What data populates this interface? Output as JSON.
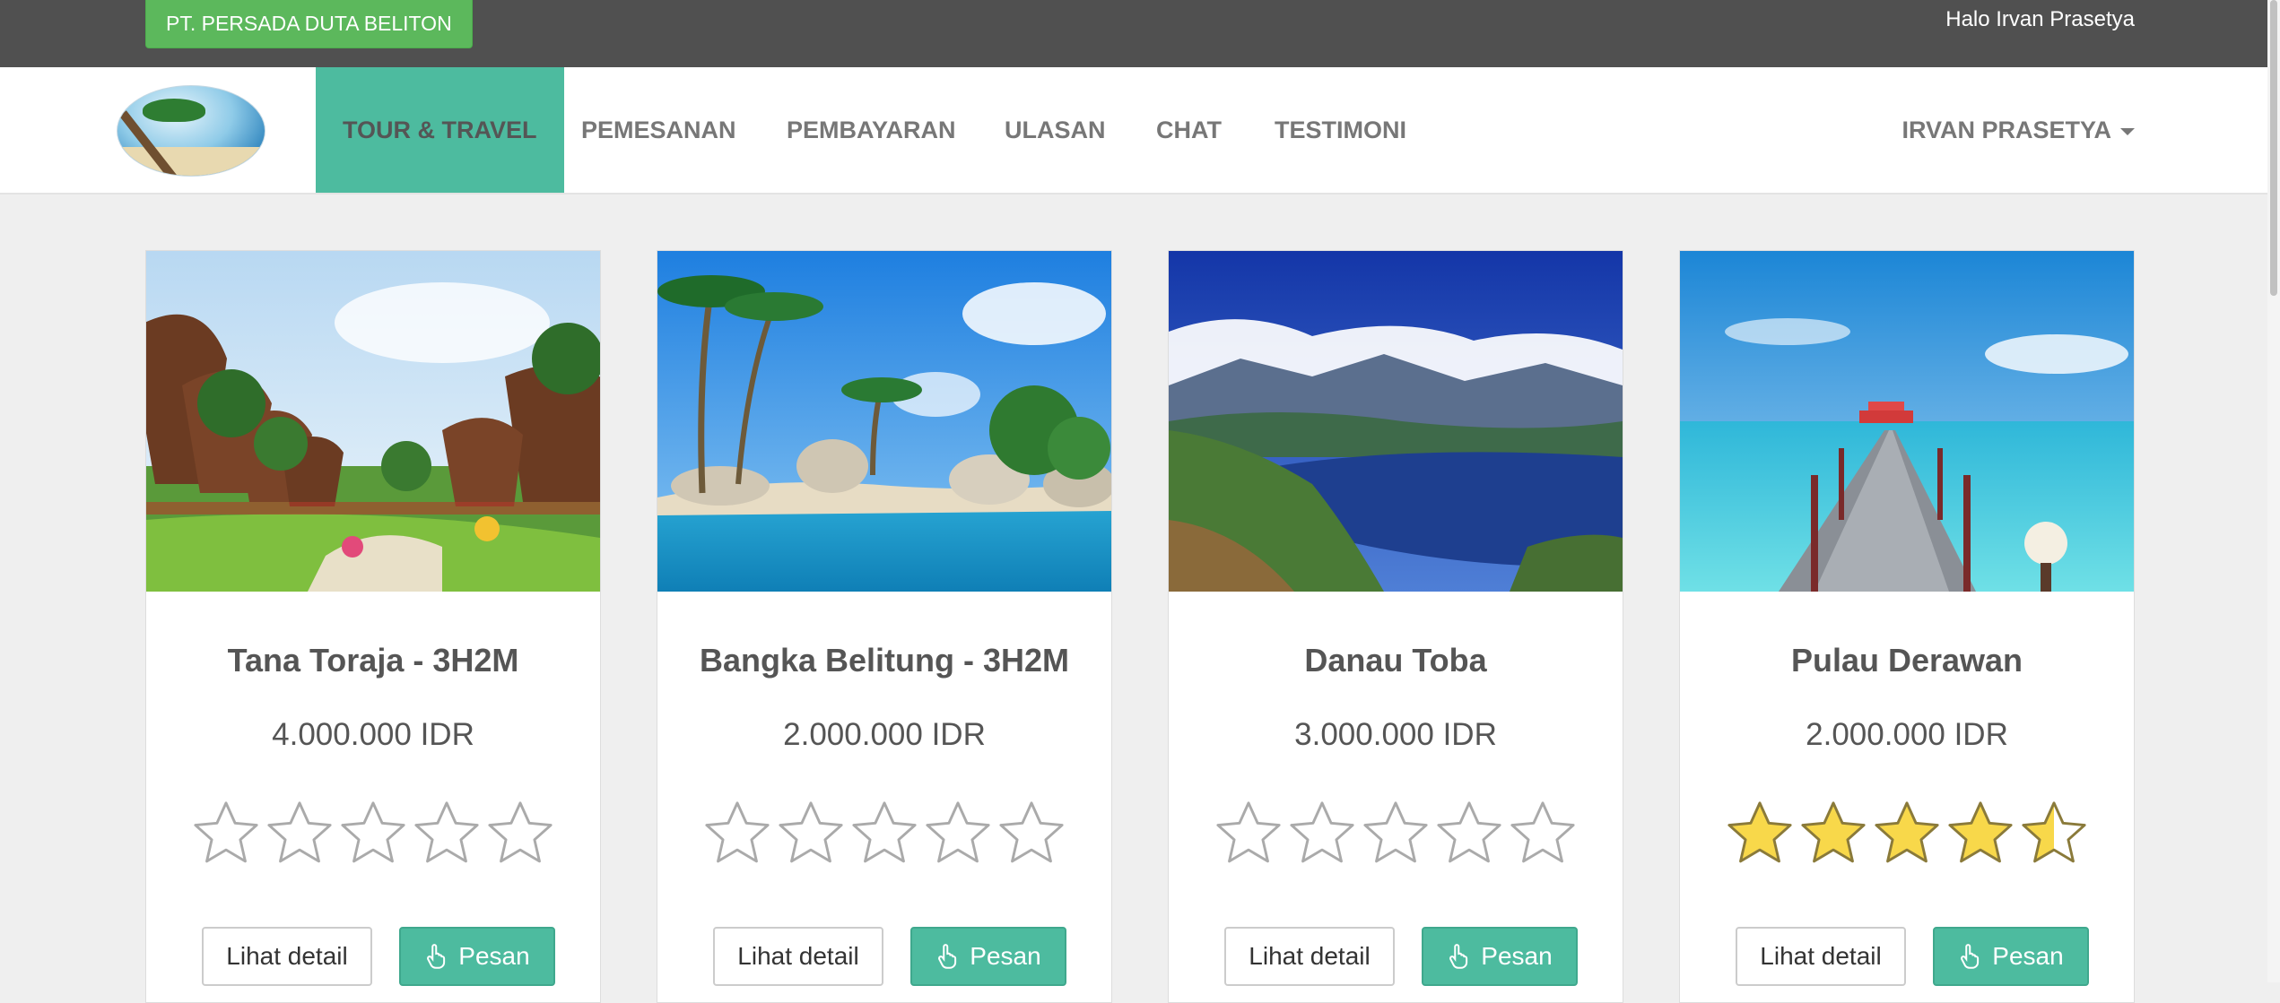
{
  "topbar": {
    "company": "PT. PERSADA DUTA BELITON",
    "greeting": "Halo Irvan Prasetya"
  },
  "navbar": {
    "logo_alt_icon": "beach-palm-logo",
    "items": [
      {
        "label": "TOUR & TRAVEL",
        "active": true
      },
      {
        "label": "PEMESANAN",
        "active": false
      },
      {
        "label": "PEMBAYARAN",
        "active": false
      },
      {
        "label": "ULASAN",
        "active": false
      },
      {
        "label": "CHAT",
        "active": false
      },
      {
        "label": "TESTIMONI",
        "active": false
      }
    ],
    "user_menu": "IRVAN PRASETYA"
  },
  "colors": {
    "accent": "#4dbb9f",
    "badge_green": "#5cb85c",
    "topbar": "#505050",
    "star_filled": "#f8d84a",
    "star_empty": "#ffffff"
  },
  "cards": [
    {
      "title": "Tana Toraja - 3H2M",
      "price": "4.000.000 IDR",
      "rating": 0,
      "detail_label": "Lihat detail",
      "order_label": "Pesan",
      "image": "toraja-houses-garden"
    },
    {
      "title": "Bangka Belitung - 3H2M",
      "price": "2.000.000 IDR",
      "rating": 0,
      "detail_label": "Lihat detail",
      "order_label": "Pesan",
      "image": "beach-palms-rocks"
    },
    {
      "title": "Danau Toba",
      "price": "3.000.000 IDR",
      "rating": 0,
      "detail_label": "Lihat detail",
      "order_label": "Pesan",
      "image": "lake-mountains"
    },
    {
      "title": "Pulau Derawan",
      "price": "2.000.000 IDR",
      "rating": 4.5,
      "detail_label": "Lihat detail",
      "order_label": "Pesan",
      "image": "pier-turquoise-sea"
    }
  ]
}
